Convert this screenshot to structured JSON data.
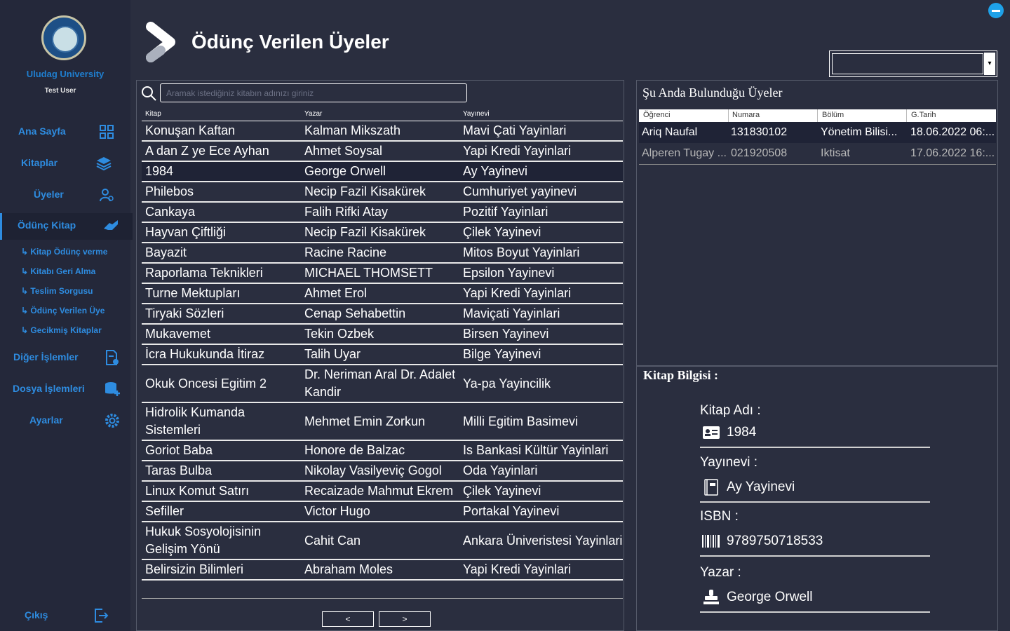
{
  "sidebar": {
    "university": "Uludag University",
    "user": "Test User",
    "nav": [
      {
        "label": "Ana Sayfa"
      },
      {
        "label": "Kitaplar"
      },
      {
        "label": "Üyeler"
      },
      {
        "label": "Ödünç Kitap"
      },
      {
        "label": "Diğer İşlemler"
      },
      {
        "label": "Dosya İşlemleri"
      },
      {
        "label": "Ayarlar"
      }
    ],
    "sub": [
      {
        "label": "↳ Kitap Ödünç verme"
      },
      {
        "label": "↳ Kitabı Geri Alma"
      },
      {
        "label": "↳ Teslim Sorgusu"
      },
      {
        "label": "↳ Ödünç Verilen Üye"
      },
      {
        "label": "↳ Gecikmiş Kitaplar"
      }
    ],
    "exit": "Çıkış"
  },
  "header": {
    "title": "Ödünç Verilen Üyeler"
  },
  "search": {
    "placeholder": "Aramak istediğiniz kitabın adınızı giriniz"
  },
  "books": {
    "headers": [
      "Kitap",
      "Yazar",
      "Yayınevi"
    ],
    "rows": [
      {
        "kitap": "Konuşan Kaftan",
        "yazar": "Kalman  Mikszath",
        "yayinevi": "Mavi Çati Yayinlari"
      },
      {
        "kitap": "A dan Z ye Ece Ayhan",
        "yazar": "Ahmet  Soysal",
        "yayinevi": "Yapi Kredi Yayinlari"
      },
      {
        "kitap": "1984",
        "yazar": "George Orwell",
        "yayinevi": "Ay Yayinevi"
      },
      {
        "kitap": "Philebos",
        "yazar": "Necip Fazil Kisakürek",
        "yayinevi": "Cumhuriyet yayinevi"
      },
      {
        "kitap": "Cankaya",
        "yazar": "Falih Rifki Atay",
        "yayinevi": "Pozitif Yayinlari"
      },
      {
        "kitap": "Hayvan Çiftliği",
        "yazar": "Necip Fazil Kisakürek",
        "yayinevi": "Çilek Yayinevi"
      },
      {
        "kitap": "Bayazit",
        "yazar": "Racine Racine",
        "yayinevi": "Mitos Boyut Yayinlari"
      },
      {
        "kitap": "Raporlama Teknikleri",
        "yazar": "MICHAEL  THOMSETT",
        "yayinevi": "Epsilon Yayinevi"
      },
      {
        "kitap": "Turne Mektupları",
        "yazar": "Ahmet Erol",
        "yayinevi": "Yapi Kredi Yayinlari"
      },
      {
        "kitap": "Tiryaki Sözleri",
        "yazar": "Cenap Sehabettin",
        "yayinevi": "Maviçati Yayinlari"
      },
      {
        "kitap": "Mukavemet",
        "yazar": "Tekin  Ozbek",
        "yayinevi": "Birsen Yayinevi"
      },
      {
        "kitap": "İcra Hukukunda İtiraz",
        "yazar": "Talih Uyar",
        "yayinevi": "Bilge Yayinevi"
      },
      {
        "kitap": "Okuk Oncesi Egitim 2",
        "yazar": "Dr. Neriman Aral Dr. Adalet Kandir",
        "yayinevi": "Ya-pa Yayincilik"
      },
      {
        "kitap": "Hidrolik Kumanda Sistemleri",
        "yazar": "Mehmet Emin Zorkun",
        "yayinevi": "Milli Egitim Basimevi"
      },
      {
        "kitap": "Goriot Baba",
        "yazar": "Honore de Balzac",
        "yayinevi": "Is Bankasi Kültür Yayinlari"
      },
      {
        "kitap": "Taras Bulba",
        "yazar": "Nikolay Vasilyeviç Gogol",
        "yayinevi": "Oda Yayinlari"
      },
      {
        "kitap": "Linux Komut Satırı",
        "yazar": "Recaizade Mahmut Ekrem",
        "yayinevi": "Çilek Yayinevi"
      },
      {
        "kitap": "Sefiller",
        "yazar": "Victor Hugo",
        "yayinevi": "Portakal Yayinevi"
      },
      {
        "kitap": "Hukuk Sosyolojisinin Gelişim Yönü",
        "yazar": "Cahit Can",
        "yayinevi": "Ankara Üniveristesi Yayinlari"
      },
      {
        "kitap": "Belirsizin Bilimleri",
        "yazar": "Abraham Moles",
        "yayinevi": "Yapi Kredi Yayinlari"
      }
    ],
    "selected_row": 2
  },
  "pager": {
    "prev": "<",
    "next": ">"
  },
  "members": {
    "title": "Şu Anda Bulunduğu Üyeler",
    "headers": [
      "Öğrenci",
      "Numara",
      "Bölüm",
      "G.Tarih"
    ],
    "rows": [
      {
        "ogrenci": "Ariq Naufal",
        "numara": "131830102",
        "bolum": "Yönetim Bilisi...",
        "tarih": "18.06.2022 06:..."
      },
      {
        "ogrenci": "Alperen Tugay ...",
        "numara": "021920508",
        "bolum": "Iktisat",
        "tarih": "17.06.2022 16:..."
      }
    ]
  },
  "book_info": {
    "title": "Kitap Bilgisi :",
    "kitap_adi_label": "Kitap Adı :",
    "kitap_adi": "1984",
    "yayinevi_label": "Yayınevi :",
    "yayinevi": "Ay Yayinevi",
    "isbn_label": "ISBN :",
    "isbn": "9789750718533",
    "yazar_label": "Yazar :",
    "yazar": "George Orwell"
  },
  "colors": {
    "accent": "#2e8ce0",
    "background": "#2a2e3f",
    "sidebar": "#24283a"
  }
}
